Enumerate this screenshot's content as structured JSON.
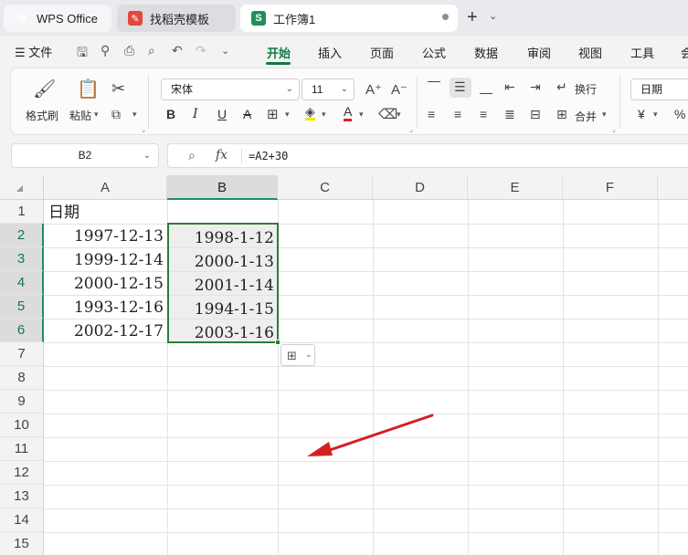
{
  "tabs": [
    {
      "label": "WPS Office",
      "icon": "wps-logo-icon"
    },
    {
      "label": "找稻壳模板",
      "icon": "daoke-icon"
    },
    {
      "label": "工作簿1",
      "icon": "spreadsheet-icon",
      "icon_letter": "S"
    }
  ],
  "menu": {
    "file_label": "文件",
    "tabs": [
      "开始",
      "插入",
      "页面",
      "公式",
      "数据",
      "审阅",
      "视图",
      "工具",
      "会"
    ],
    "active": "开始"
  },
  "ribbon": {
    "format_painter": "格式刷",
    "paste": "粘贴",
    "font_name": "宋体",
    "font_size": "11",
    "wrap": "换行",
    "merge": "合并",
    "number_format": "日期",
    "currency_symbol": "¥",
    "percent_symbol": "%",
    "bold": "B",
    "italic": "I",
    "underline": "U",
    "strike": "A",
    "font_color": "A"
  },
  "formula_bar": {
    "name_box": "B2",
    "fx": "fx",
    "formula": "=A2+30"
  },
  "grid": {
    "columns": [
      "A",
      "B",
      "C",
      "D",
      "E",
      "F"
    ],
    "selected_column": "B",
    "rows": [
      "1",
      "2",
      "3",
      "4",
      "5",
      "6",
      "7",
      "8",
      "9",
      "10",
      "11",
      "12",
      "13",
      "14",
      "15"
    ],
    "selected_rows": [
      "2",
      "3",
      "4",
      "5",
      "6"
    ],
    "col_a_header": "日期",
    "col_a": [
      "1997-12-13",
      "1999-12-14",
      "2000-12-15",
      "1993-12-16",
      "2002-12-17"
    ],
    "col_b": [
      "1998-1-12",
      "2000-1-13",
      "2001-1-14",
      "1994-1-15",
      "2003-1-16"
    ]
  },
  "colors": {
    "accent_green": "#0f7b44",
    "selection_border": "#2e7d32",
    "annotation_arrow": "#d42020"
  }
}
